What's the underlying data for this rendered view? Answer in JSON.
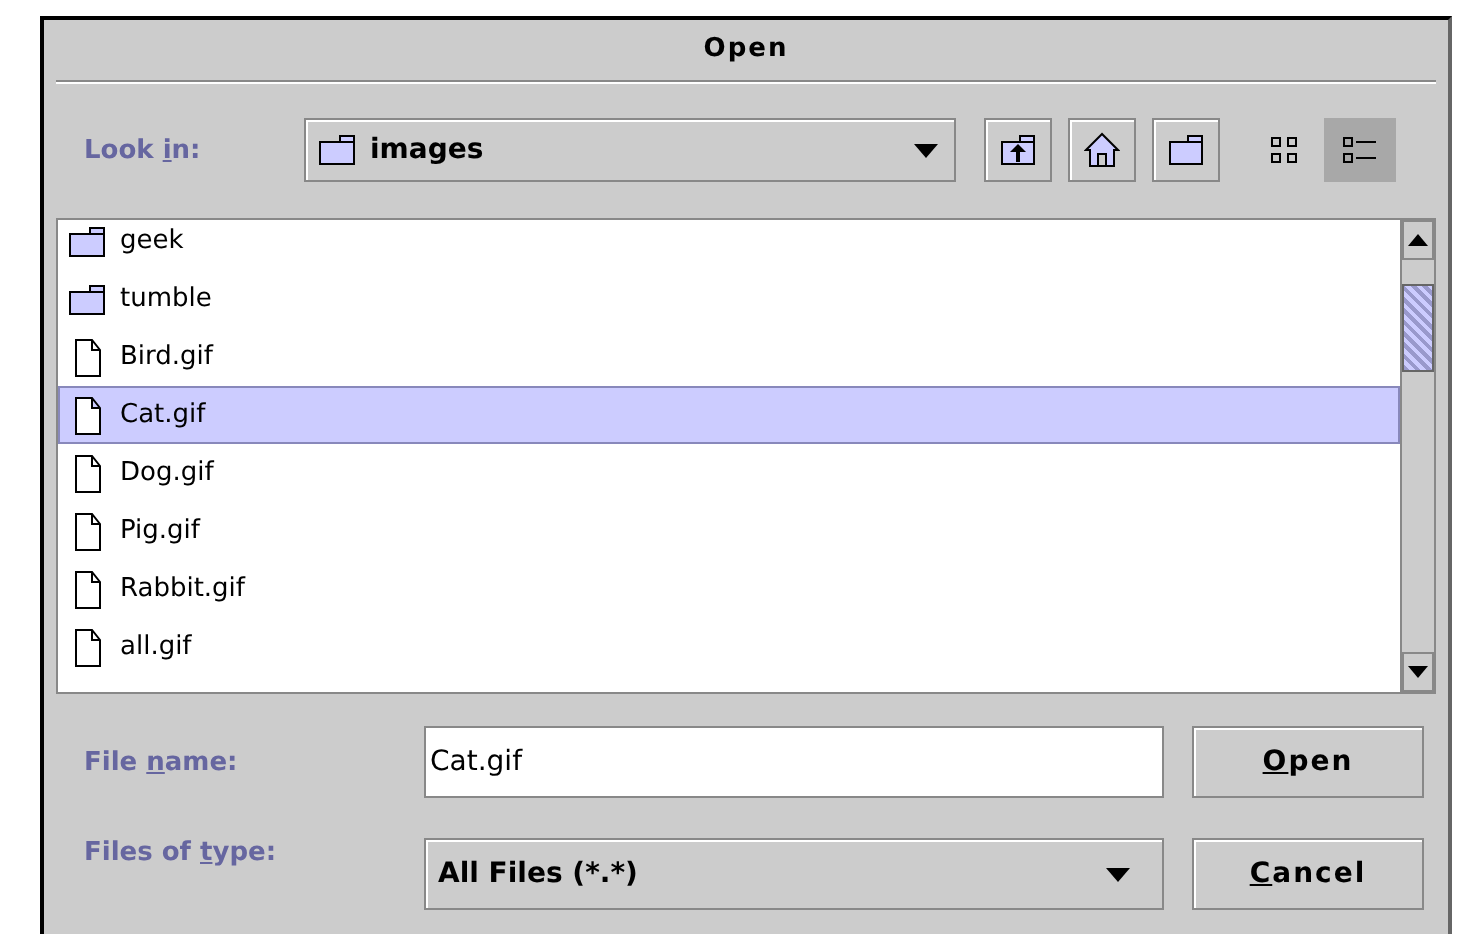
{
  "window": {
    "title": "Open"
  },
  "look_in": {
    "label_before": "Look ",
    "label_key": "i",
    "label_after": "n:",
    "value": "images"
  },
  "toolbar": [
    {
      "kind": "up"
    },
    {
      "kind": "home"
    },
    {
      "kind": "new_folder"
    },
    {
      "kind": "list_view",
      "selected": false
    },
    {
      "kind": "details_view",
      "selected": true
    }
  ],
  "files": [
    {
      "name": "geek",
      "kind": "folder",
      "selected": false
    },
    {
      "name": "tumble",
      "kind": "folder",
      "selected": false
    },
    {
      "name": "Bird.gif",
      "kind": "file",
      "selected": false
    },
    {
      "name": "Cat.gif",
      "kind": "file",
      "selected": true
    },
    {
      "name": "Dog.gif",
      "kind": "file",
      "selected": false
    },
    {
      "name": "Pig.gif",
      "kind": "file",
      "selected": false
    },
    {
      "name": "Rabbit.gif",
      "kind": "file",
      "selected": false
    },
    {
      "name": "all.gif",
      "kind": "file",
      "selected": false
    }
  ],
  "file_name": {
    "label_before": "File ",
    "label_key": "n",
    "label_after": "ame:",
    "value": "Cat.gif"
  },
  "file_type": {
    "label_before": "Files of ",
    "label_key": "t",
    "label_after": "ype:",
    "value": "All Files (*.*)"
  },
  "buttons": [
    {
      "key": "O",
      "after": "pen"
    },
    {
      "key": "C",
      "after": "ancel"
    }
  ]
}
